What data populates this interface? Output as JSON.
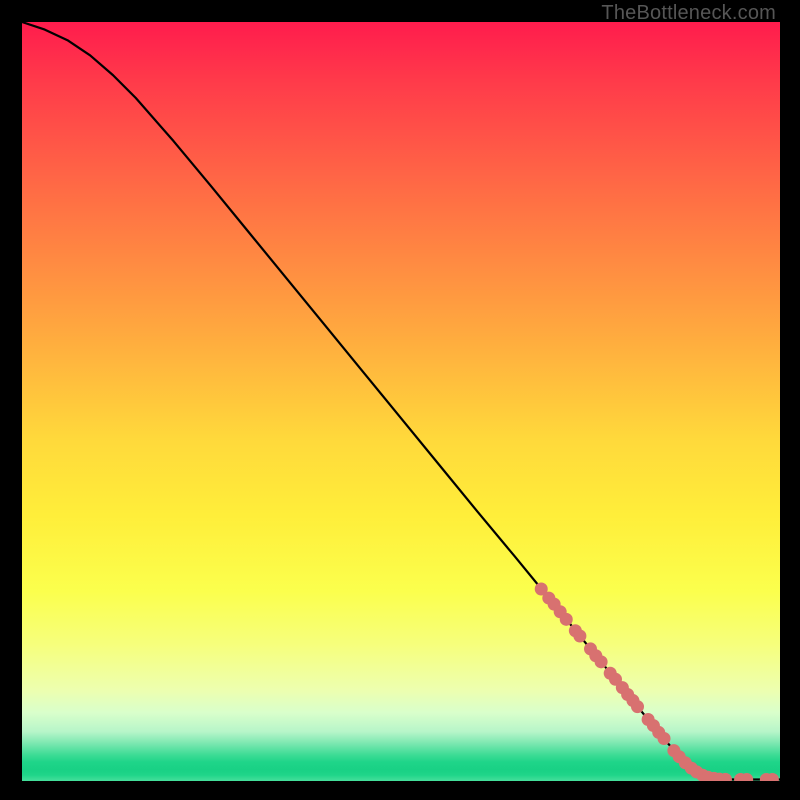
{
  "attribution": "TheBottleneck.com",
  "colors": {
    "background": "#000000",
    "curve": "#000000",
    "marker_fill": "#d87170",
    "gradient_top": "#ff1c4d",
    "gradient_mid": "#ffee3a",
    "gradient_bottom": "#1fd589"
  },
  "plot": {
    "inner_left": 22,
    "inner_top": 22,
    "inner_width": 758,
    "inner_height": 759
  },
  "chart_data": {
    "type": "line",
    "title": "",
    "xlabel": "",
    "ylabel": "",
    "xlim": [
      0,
      100
    ],
    "ylim": [
      0,
      100
    ],
    "curve": [
      {
        "x": 0,
        "y": 100.0
      },
      {
        "x": 3,
        "y": 99.0
      },
      {
        "x": 6,
        "y": 97.6
      },
      {
        "x": 9,
        "y": 95.6
      },
      {
        "x": 12,
        "y": 93.0
      },
      {
        "x": 15,
        "y": 90.0
      },
      {
        "x": 20,
        "y": 84.3
      },
      {
        "x": 25,
        "y": 78.3
      },
      {
        "x": 30,
        "y": 72.2
      },
      {
        "x": 35,
        "y": 66.1
      },
      {
        "x": 40,
        "y": 60.0
      },
      {
        "x": 45,
        "y": 53.9
      },
      {
        "x": 50,
        "y": 47.8
      },
      {
        "x": 55,
        "y": 41.7
      },
      {
        "x": 60,
        "y": 35.6
      },
      {
        "x": 65,
        "y": 29.6
      },
      {
        "x": 70,
        "y": 23.5
      },
      {
        "x": 75,
        "y": 17.4
      },
      {
        "x": 80,
        "y": 11.3
      },
      {
        "x": 83,
        "y": 7.6
      },
      {
        "x": 85,
        "y": 5.2
      },
      {
        "x": 86.5,
        "y": 3.5
      },
      {
        "x": 87.5,
        "y": 2.4
      },
      {
        "x": 88.5,
        "y": 1.5
      },
      {
        "x": 89.5,
        "y": 0.9
      },
      {
        "x": 90.5,
        "y": 0.5
      },
      {
        "x": 92,
        "y": 0.25
      },
      {
        "x": 94,
        "y": 0.2
      },
      {
        "x": 97,
        "y": 0.2
      },
      {
        "x": 100,
        "y": 0.2
      }
    ],
    "markers": [
      {
        "x": 68.5,
        "y": 25.3
      },
      {
        "x": 69.5,
        "y": 24.1
      },
      {
        "x": 70.2,
        "y": 23.3
      },
      {
        "x": 71.0,
        "y": 22.3
      },
      {
        "x": 71.8,
        "y": 21.3
      },
      {
        "x": 73.0,
        "y": 19.8
      },
      {
        "x": 73.6,
        "y": 19.1
      },
      {
        "x": 75.0,
        "y": 17.4
      },
      {
        "x": 75.7,
        "y": 16.5
      },
      {
        "x": 76.4,
        "y": 15.7
      },
      {
        "x": 77.6,
        "y": 14.2
      },
      {
        "x": 78.3,
        "y": 13.4
      },
      {
        "x": 79.2,
        "y": 12.3
      },
      {
        "x": 79.9,
        "y": 11.4
      },
      {
        "x": 80.6,
        "y": 10.6
      },
      {
        "x": 81.2,
        "y": 9.8
      },
      {
        "x": 82.6,
        "y": 8.1
      },
      {
        "x": 83.3,
        "y": 7.3
      },
      {
        "x": 84.0,
        "y": 6.4
      },
      {
        "x": 84.7,
        "y": 5.6
      },
      {
        "x": 86.0,
        "y": 4.0
      },
      {
        "x": 86.7,
        "y": 3.2
      },
      {
        "x": 87.5,
        "y": 2.4
      },
      {
        "x": 88.3,
        "y": 1.7
      },
      {
        "x": 89.0,
        "y": 1.2
      },
      {
        "x": 89.8,
        "y": 0.75
      },
      {
        "x": 90.5,
        "y": 0.5
      },
      {
        "x": 91.3,
        "y": 0.35
      },
      {
        "x": 92.0,
        "y": 0.25
      },
      {
        "x": 92.8,
        "y": 0.22
      },
      {
        "x": 94.8,
        "y": 0.2
      },
      {
        "x": 95.6,
        "y": 0.2
      },
      {
        "x": 98.2,
        "y": 0.2
      },
      {
        "x": 99.0,
        "y": 0.2
      }
    ],
    "marker_radius_px": 6.5
  }
}
